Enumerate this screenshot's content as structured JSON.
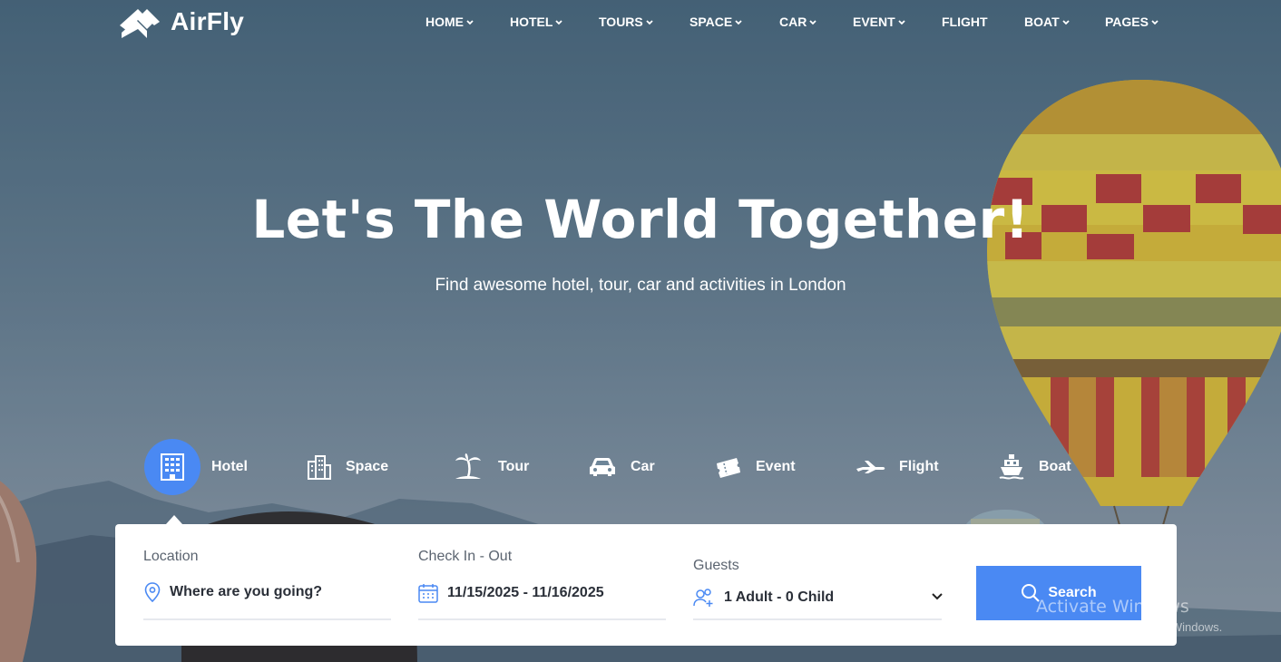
{
  "brand": {
    "name": "AirFly"
  },
  "nav": [
    {
      "label": "HOME",
      "dropdown": true
    },
    {
      "label": "HOTEL",
      "dropdown": true
    },
    {
      "label": "TOURS",
      "dropdown": true
    },
    {
      "label": "SPACE",
      "dropdown": true
    },
    {
      "label": "CAR",
      "dropdown": true
    },
    {
      "label": "EVENT",
      "dropdown": true
    },
    {
      "label": "FLIGHT",
      "dropdown": false
    },
    {
      "label": "BOAT",
      "dropdown": true
    },
    {
      "label": "PAGES",
      "dropdown": true
    }
  ],
  "hero": {
    "title": "Let's The World Together!",
    "subtitle": "Find awesome hotel, tour, car and activities in London"
  },
  "tabs": [
    {
      "label": "Hotel",
      "icon": "hotel-icon",
      "active": true
    },
    {
      "label": "Space",
      "icon": "building-icon",
      "active": false
    },
    {
      "label": "Tour",
      "icon": "palm-tree-icon",
      "active": false
    },
    {
      "label": "Car",
      "icon": "car-icon",
      "active": false
    },
    {
      "label": "Event",
      "icon": "ticket-icon",
      "active": false
    },
    {
      "label": "Flight",
      "icon": "airplane-icon",
      "active": false
    },
    {
      "label": "Boat",
      "icon": "ship-icon",
      "active": false
    }
  ],
  "search": {
    "location_label": "Location",
    "location_placeholder": "Where are you going?",
    "dates_label": "Check In - Out",
    "dates_value": "11/15/2025 - 11/16/2025",
    "guests_label": "Guests",
    "guests_value": "1 Adult - 0 Child",
    "button_label": "Search"
  },
  "watermark": {
    "title": "Activate Windows",
    "subtitle": "Go to Settings to activate Windows."
  },
  "colors": {
    "accent": "#4a89f3",
    "white": "#ffffff",
    "text_dark": "#2a2f38"
  }
}
